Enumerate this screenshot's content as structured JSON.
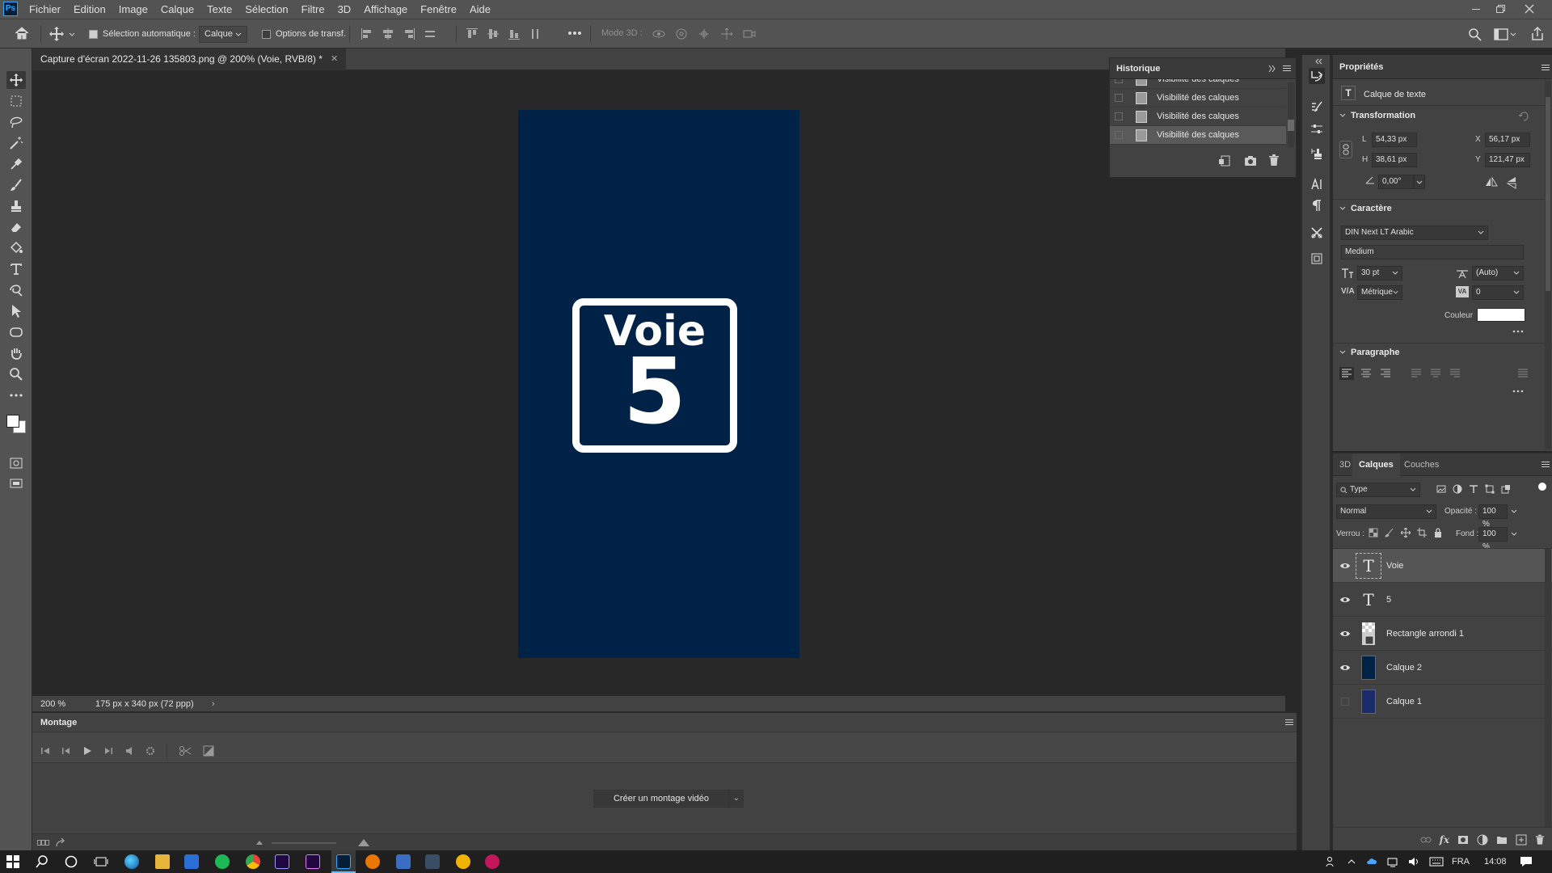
{
  "app": {
    "logo_text": "Ps"
  },
  "menu": [
    "Fichier",
    "Edition",
    "Image",
    "Calque",
    "Texte",
    "Sélection",
    "Filtre",
    "3D",
    "Affichage",
    "Fenêtre",
    "Aide"
  ],
  "options": {
    "auto_select_label": "Sélection automatique :",
    "auto_select_target": "Calque",
    "transform_options_label": "Options de transf.",
    "mode3d_label": "Mode 3D :"
  },
  "document": {
    "tab_title": "Capture d'écran 2022-11-26 135803.png @ 200% (Voie, RVB/8) *",
    "zoom": "200 %",
    "size_info": "175 px x 340 px (72 ppp)"
  },
  "canvas": {
    "bg_color": "#002246",
    "sign_word": "Voie",
    "sign_number": "5"
  },
  "timeline": {
    "title": "Montage",
    "create_button": "Créer un montage vidéo"
  },
  "history": {
    "title": "Historique",
    "items": [
      {
        "label": "Visibilité des calques",
        "selected": false
      },
      {
        "label": "Visibilité des calques",
        "selected": false
      },
      {
        "label": "Visibilité des calques",
        "selected": false
      },
      {
        "label": "Visibilité des calques",
        "selected": true
      }
    ]
  },
  "properties": {
    "title": "Propriétés",
    "layer_kind": "Calque de texte",
    "transformation": {
      "title": "Transformation",
      "w_label": "L",
      "w": "54,33 px",
      "h_label": "H",
      "h": "38,61 px",
      "x_label": "X",
      "x": "56,17 px",
      "y_label": "Y",
      "y": "121,47 px",
      "angle": "0,00°"
    },
    "character": {
      "title": "Caractère",
      "font": "DIN Next LT Arabic",
      "style": "Medium",
      "size": "30 pt",
      "leading": "(Auto)",
      "kerning": "Métrique",
      "tracking": "0",
      "color_label": "Couleur",
      "color": "#ffffff"
    },
    "paragraph": {
      "title": "Paragraphe"
    }
  },
  "layers": {
    "tabs": [
      "3D",
      "Calques",
      "Couches"
    ],
    "active_tab": "Calques",
    "filter": "Type",
    "blend_mode": "Normal",
    "opacity_label": "Opacité :",
    "opacity": "100 %",
    "lock_label": "Verrou :",
    "fill_label": "Fond :",
    "fill": "100 %",
    "items": [
      {
        "name": "Voie",
        "kind": "text",
        "visible": true,
        "selected": true
      },
      {
        "name": "5",
        "kind": "text",
        "visible": true,
        "selected": false
      },
      {
        "name": "Rectangle arrondi 1",
        "kind": "shape",
        "visible": true,
        "selected": false
      },
      {
        "name": "Calque 2",
        "kind": "fill",
        "visible": true,
        "selected": false
      },
      {
        "name": "Calque 1",
        "kind": "image",
        "visible": false,
        "selected": false
      }
    ]
  },
  "taskbar": {
    "lang": "FRA",
    "time": "14:08"
  }
}
